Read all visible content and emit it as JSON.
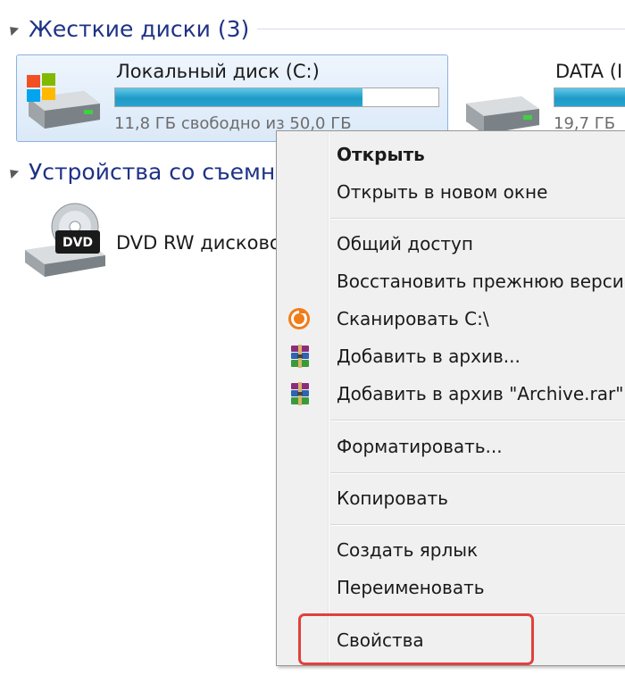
{
  "groups": {
    "hard_drives_title": "Жесткие диски (3)",
    "removable_title": "Устройства со съемн"
  },
  "drives": {
    "c": {
      "name": "Локальный диск (C:)",
      "free_text": "11,8 ГБ свободно из 50,0 ГБ",
      "used_fraction": 0.764,
      "icon": "windows-drive-icon"
    },
    "data": {
      "name": "DATA (I",
      "free_text": "19,7 ГБ",
      "icon": "hard-drive-icon"
    },
    "dvd": {
      "name": "DVD RW дисково",
      "badge": "DVD",
      "icon": "dvd-drive-icon"
    }
  },
  "context_menu": {
    "open": "Открыть",
    "open_new_window": "Открыть в новом окне",
    "sharing": "Общий доступ",
    "restore_previous": "Восстановить прежнюю верси",
    "scan": "Сканировать C:\\",
    "add_archive": "Добавить в архив...",
    "add_archive_rar": "Добавить в архив \"Archive.rar\"",
    "format": "Форматировать...",
    "copy": "Копировать",
    "create_shortcut": "Создать ярлык",
    "rename": "Переименовать",
    "properties": "Свойства"
  },
  "colors": {
    "group_title": "#1e3287",
    "progress_fill": "#1f9ac6",
    "highlight_box": "#e0413d",
    "menu_background": "#f0f0f0"
  }
}
